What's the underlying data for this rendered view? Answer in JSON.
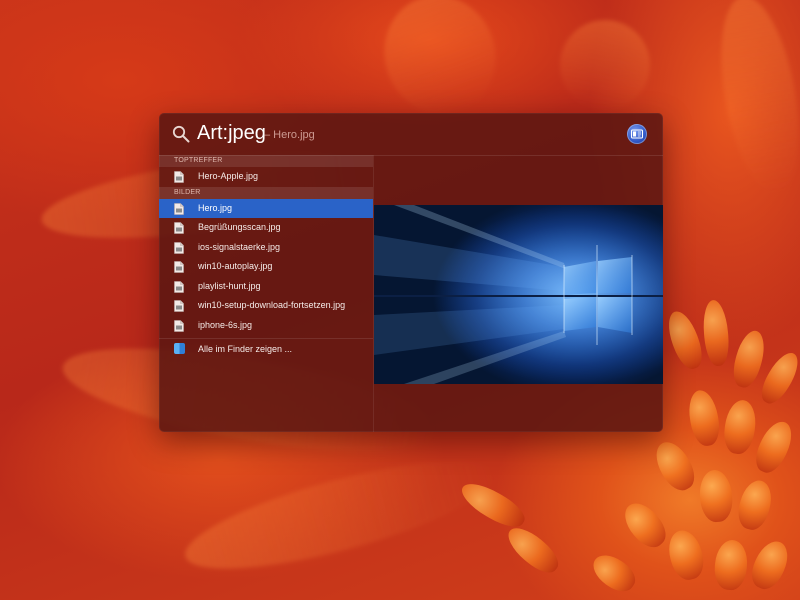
{
  "search": {
    "query": "Art:jpeg",
    "suffix": "– Hero.jpg",
    "icon": "magnifying-glass-icon",
    "preview_toggle_icon": "preview-panel-icon"
  },
  "sections": [
    {
      "header": "TOPTREFFER",
      "items": [
        {
          "label": "Hero-Apple.jpg",
          "icon": "image-file-icon",
          "selected": false
        }
      ]
    },
    {
      "header": "BILDER",
      "items": [
        {
          "label": "Hero.jpg",
          "icon": "image-file-icon",
          "selected": true
        },
        {
          "label": "Begrüßungsscan.jpg",
          "icon": "image-file-icon",
          "selected": false
        },
        {
          "label": "ios-signalstaerke.jpg",
          "icon": "image-file-icon",
          "selected": false
        },
        {
          "label": "win10-autoplay.jpg",
          "icon": "image-file-icon",
          "selected": false
        },
        {
          "label": "playlist-hunt.jpg",
          "icon": "image-file-icon",
          "selected": false
        },
        {
          "label": "win10-setup-download-fortsetzen.jpg",
          "icon": "image-file-icon",
          "selected": false
        },
        {
          "label": "iphone-6s.jpg",
          "icon": "image-file-icon",
          "selected": false
        }
      ]
    }
  ],
  "finder_action": {
    "label": "Alle im Finder zeigen ...",
    "icon": "finder-icon"
  },
  "preview": {
    "image": "windows-10-hero-wallpaper"
  },
  "colors": {
    "selection": "#2a63c8",
    "panel": "#5a1612",
    "wallpaper": "#c8331a"
  }
}
